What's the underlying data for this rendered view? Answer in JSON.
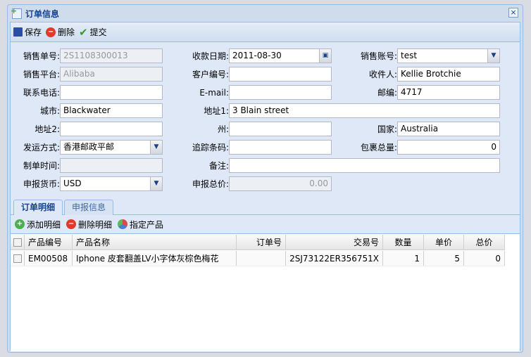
{
  "window": {
    "title": "订单信息",
    "close": "×"
  },
  "toolbar": {
    "save": "保存",
    "delete": "删除",
    "submit": "提交"
  },
  "form": {
    "sale_no": {
      "label": "销售单号:",
      "value": "2S1108300013"
    },
    "pay_date": {
      "label": "收款日期:",
      "value": "2011-08-30"
    },
    "sale_account": {
      "label": "销售账号:",
      "value": "test"
    },
    "platform": {
      "label": "销售平台:",
      "value": "Alibaba"
    },
    "customer_no": {
      "label": "客户编号:",
      "value": ""
    },
    "recipient": {
      "label": "收件人:",
      "value": "Kellie Brotchie"
    },
    "phone": {
      "label": "联系电话:",
      "value": ""
    },
    "email": {
      "label": "E-mail:",
      "value": ""
    },
    "postcode": {
      "label": "邮编:",
      "value": "4717"
    },
    "city": {
      "label": "城市:",
      "value": "Blackwater"
    },
    "address1": {
      "label": "地址1:",
      "value": "3 Blain street"
    },
    "address2": {
      "label": "地址2:",
      "value": ""
    },
    "state": {
      "label": "州:",
      "value": ""
    },
    "country": {
      "label": "国家:",
      "value": "Australia"
    },
    "ship_method": {
      "label": "发运方式:",
      "value": "香港邮政平邮"
    },
    "tracking": {
      "label": "追踪条码:",
      "value": ""
    },
    "package_weight": {
      "label": "包裹总量:",
      "value": "0"
    },
    "created": {
      "label": "制单时间:",
      "value": ""
    },
    "remark": {
      "label": "备注:",
      "value": ""
    },
    "currency": {
      "label": "申报货币:",
      "value": "USD"
    },
    "declared_total": {
      "label": "申报总价:",
      "value": "0.00"
    }
  },
  "tabs": [
    {
      "label": "订单明细"
    },
    {
      "label": "申报信息"
    }
  ],
  "grid_toolbar": {
    "add": "添加明细",
    "delete": "删除明细",
    "assign": "指定产品"
  },
  "grid": {
    "columns": [
      "产品编号",
      "产品名称",
      "订单号",
      "交易号",
      "数量",
      "单价",
      "总价"
    ],
    "rows": [
      [
        "EM00508",
        "Iphone 皮套翻盖LV小字体灰棕色梅花",
        "",
        "2SJ73122ER356751X",
        "1",
        "5",
        "0"
      ]
    ]
  }
}
